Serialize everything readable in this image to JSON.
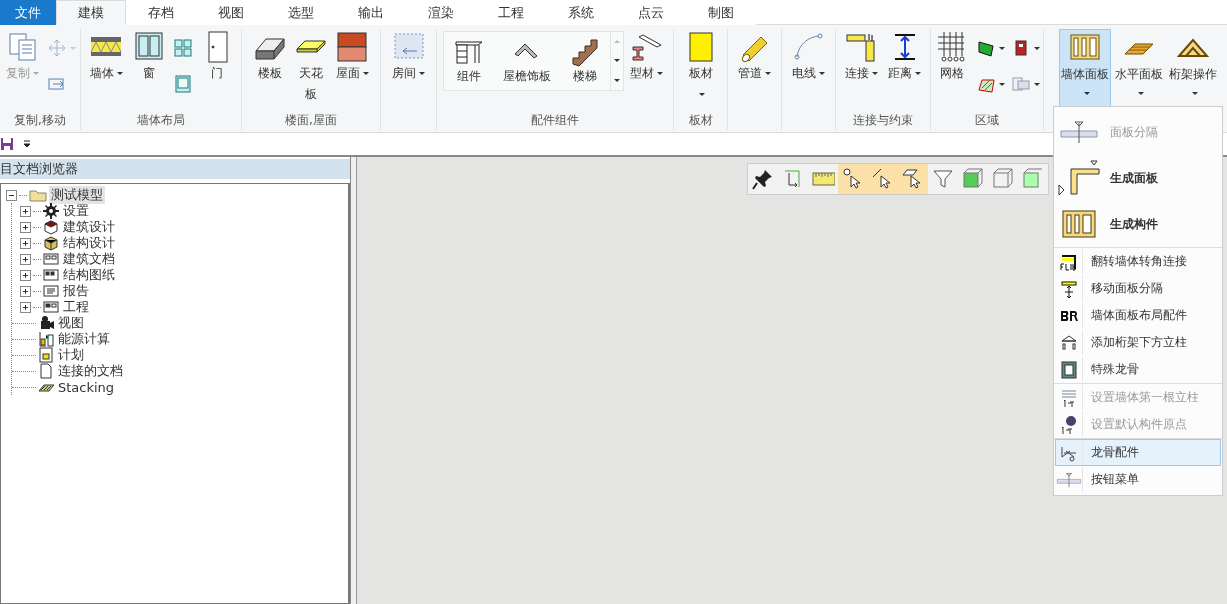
{
  "tabs": [
    {
      "label": "文件",
      "kind": "file",
      "selected": false
    },
    {
      "label": "建模",
      "kind": "tab",
      "selected": true
    },
    {
      "label": "存档",
      "kind": "tab",
      "selected": false
    },
    {
      "label": "视图",
      "kind": "tab",
      "selected": false
    },
    {
      "label": "选型",
      "kind": "tab",
      "selected": false
    },
    {
      "label": "输出",
      "kind": "tab",
      "selected": false
    },
    {
      "label": "渲染",
      "kind": "tab",
      "selected": false
    },
    {
      "label": "工程",
      "kind": "tab",
      "selected": false
    },
    {
      "label": "系统",
      "kind": "tab",
      "selected": false
    },
    {
      "label": "点云",
      "kind": "tab",
      "selected": false
    },
    {
      "label": "制图",
      "kind": "tab",
      "selected": false
    }
  ],
  "ribbon": {
    "groups": [
      {
        "label": "复制,移动",
        "items": [
          {
            "kind": "large",
            "label": "复制",
            "dropdown": true,
            "disabled": true
          },
          {
            "kind": "stack",
            "items": [
              {
                "kind": "small",
                "dropdown": true,
                "disabled": true
              },
              {
                "kind": "small",
                "dropdown": false,
                "disabled": false
              }
            ]
          }
        ]
      },
      {
        "label": "墙体布局",
        "items": [
          {
            "kind": "large",
            "label": "墙体",
            "dropdown": true,
            "disabled": false
          },
          {
            "kind": "large",
            "label": "窗",
            "dropdown": false,
            "disabled": false
          },
          {
            "kind": "stack",
            "items": [
              {
                "kind": "small",
                "dropdown": false,
                "disabled": false
              },
              {
                "kind": "small",
                "dropdown": false,
                "disabled": false
              }
            ]
          },
          {
            "kind": "large",
            "label": "门",
            "dropdown": false,
            "disabled": false
          }
        ]
      },
      {
        "label": "楼面,屋面",
        "items": [
          {
            "kind": "large",
            "label": "楼板",
            "dropdown": false,
            "disabled": false
          },
          {
            "kind": "large",
            "label": "天花板",
            "dropdown": false,
            "disabled": false
          },
          {
            "kind": "large",
            "label": "屋面",
            "dropdown": true,
            "disabled": false
          }
        ]
      },
      {
        "items": [
          {
            "kind": "large",
            "label": "房间",
            "dropdown": true,
            "disabled": false
          }
        ]
      },
      {
        "label": "配件组件",
        "items": [
          {
            "kind": "gallery",
            "items": [
              {
                "label": "组件"
              },
              {
                "label": "屋檐饰板"
              },
              {
                "label": "楼梯"
              }
            ]
          },
          {
            "kind": "large",
            "label": "型材",
            "dropdown": true,
            "disabled": false
          }
        ]
      },
      {
        "label": "板材",
        "items": [
          {
            "kind": "large",
            "label": "板材",
            "dropdown": true,
            "disabled": false
          }
        ]
      },
      {
        "items": [
          {
            "kind": "large",
            "label": "管道",
            "dropdown": true,
            "disabled": false
          }
        ]
      },
      {
        "items": [
          {
            "kind": "large",
            "label": "电线",
            "dropdown": true,
            "disabled": false
          }
        ]
      },
      {
        "label": "连接与约束",
        "items": [
          {
            "kind": "large",
            "label": "连接",
            "dropdown": true,
            "disabled": false
          },
          {
            "kind": "large",
            "label": "距离",
            "dropdown": true,
            "disabled": false
          }
        ]
      },
      {
        "label": "区域",
        "items": [
          {
            "kind": "large",
            "label": "网格",
            "dropdown": false,
            "disabled": false
          },
          {
            "kind": "stack",
            "items": [
              {
                "kind": "small",
                "dropdown": true,
                "disabled": false
              },
              {
                "kind": "small",
                "dropdown": true,
                "disabled": false
              }
            ]
          },
          {
            "kind": "stack",
            "items": [
              {
                "kind": "small",
                "dropdown": true,
                "disabled": false
              },
              {
                "kind": "small",
                "dropdown": true,
                "disabled": false
              }
            ]
          }
        ]
      },
      {
        "items": [
          {
            "kind": "split",
            "label": "墙体面板",
            "selected": true
          },
          {
            "kind": "split",
            "label": "水平面板",
            "selected": false
          },
          {
            "kind": "split",
            "label": "桁架操作",
            "selected": false
          }
        ]
      }
    ]
  },
  "browser": {
    "title": "目文档浏览器",
    "tree": {
      "label": "测试模型",
      "expanded": true,
      "selected": true,
      "children": [
        {
          "label": "设置",
          "expanded": false
        },
        {
          "label": "建筑设计",
          "expanded": false
        },
        {
          "label": "结构设计",
          "expanded": false
        },
        {
          "label": "建筑文档",
          "expanded": false
        },
        {
          "label": "结构图纸",
          "expanded": false
        },
        {
          "label": "报告",
          "expanded": false
        },
        {
          "label": "工程",
          "expanded": false
        },
        {
          "label": "视图"
        },
        {
          "label": "能源计算"
        },
        {
          "label": "计划"
        },
        {
          "label": "连接的文档"
        },
        {
          "label": "Stacking"
        }
      ]
    }
  },
  "view_toolbar": [
    {
      "active": false
    },
    {
      "active": false
    },
    {
      "active": false
    },
    {
      "active": true
    },
    {
      "active": true
    },
    {
      "active": true
    },
    {
      "active": false
    },
    {
      "active": false
    },
    {
      "active": false
    },
    {
      "active": false
    }
  ],
  "menu": {
    "sections": [
      {
        "items": [
          {
            "kind": "large",
            "label": "面板分隔",
            "disabled": true,
            "selected": false
          },
          {
            "kind": "large",
            "label": "生成面板",
            "disabled": false,
            "selected": false
          },
          {
            "kind": "large",
            "label": "生成构件",
            "disabled": false,
            "selected": false
          }
        ]
      },
      {
        "items": [
          {
            "kind": "small",
            "label": "翻转墙体转角连接",
            "disabled": false,
            "selected": false
          },
          {
            "kind": "small",
            "label": "移动面板分隔",
            "disabled": false,
            "selected": false
          },
          {
            "kind": "small",
            "label": "墙体面板布局配件",
            "disabled": false,
            "selected": false
          },
          {
            "kind": "small",
            "label": "添加桁架下方立柱",
            "disabled": false,
            "selected": false
          },
          {
            "kind": "small",
            "label": "特殊龙骨",
            "disabled": false,
            "selected": false
          }
        ]
      },
      {
        "items": [
          {
            "kind": "small",
            "label": "设置墙体第一根立柱",
            "disabled": true,
            "selected": false
          },
          {
            "kind": "small",
            "label": "设置默认构件原点",
            "disabled": true,
            "selected": false
          }
        ]
      },
      {
        "items": [
          {
            "kind": "small",
            "label": "龙骨配件",
            "disabled": false,
            "selected": true
          },
          {
            "kind": "small",
            "label": "按钮菜单",
            "disabled": false,
            "selected": false
          }
        ]
      }
    ]
  }
}
